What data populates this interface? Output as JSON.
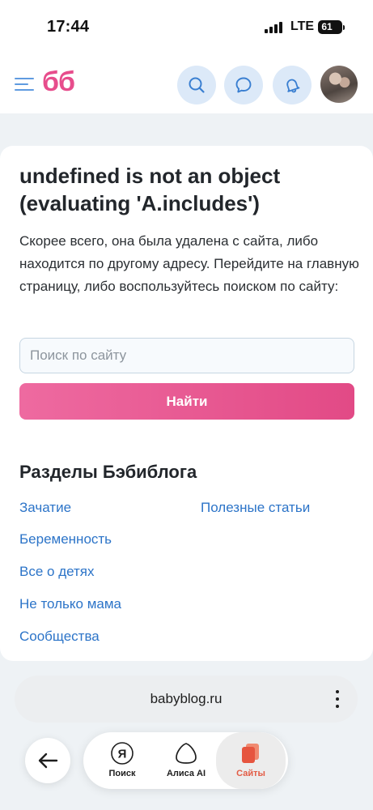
{
  "status_bar": {
    "time": "17:44",
    "network": "LTE",
    "battery": "61"
  },
  "header": {
    "logo": "бб",
    "icons": [
      "menu-icon",
      "search-icon",
      "chat-icon",
      "bell-icon",
      "avatar"
    ],
    "accent_color": "#e74d8c",
    "icon_color": "#5f9be0"
  },
  "error": {
    "title": "undefined is not an object (evaluating 'A.includes')",
    "text": "Скорее всего, она была удалена с сайта, либо находится по другому адресу. Перейдите на главную страницу, либо воспользуйтесь поиском по сайту:"
  },
  "search": {
    "placeholder": "Поиск по сайту",
    "value": "",
    "button_label": "Найти"
  },
  "sections": {
    "title": "Разделы Бэбиблога",
    "links": [
      "Зачатие",
      "Полезные статьи",
      "Беременность",
      "Все о детях",
      "Не только мама",
      "Сообщества"
    ],
    "link_color": "#2c74c8"
  },
  "browser": {
    "url": "babyblog.ru",
    "tabs": [
      {
        "label": "Поиск",
        "icon": "yandex-icon"
      },
      {
        "label": "Алиса AI",
        "icon": "alice-icon"
      },
      {
        "label": "Сайты",
        "icon": "sites-icon",
        "active": true
      }
    ],
    "active_color": "#e35c45"
  }
}
